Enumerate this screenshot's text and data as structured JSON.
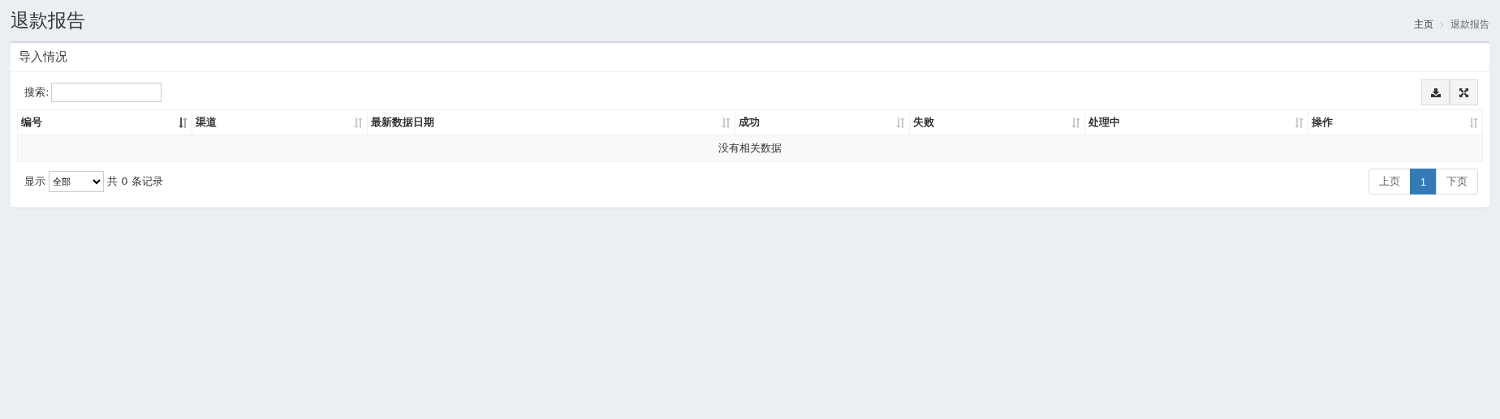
{
  "page_title": "退款报告",
  "breadcrumb": [
    {
      "label": "主页"
    },
    {
      "label": "退款报告"
    }
  ],
  "panel": {
    "title": "导入情况",
    "search": {
      "label": "搜索:"
    },
    "table": {
      "columns": [
        {
          "label": "编号",
          "sorted": true
        },
        {
          "label": "渠道",
          "sorted": false
        },
        {
          "label": "最新数据日期",
          "sorted": false
        },
        {
          "label": "成功",
          "sorted": false
        },
        {
          "label": "失败",
          "sorted": false
        },
        {
          "label": "处理中",
          "sorted": false
        },
        {
          "label": "操作",
          "sorted": false
        }
      ],
      "empty_message": "没有相关数据"
    },
    "footer": {
      "show_label": "显示",
      "page_size": "全部",
      "record_count": "共 0 条记录"
    },
    "pagination": [
      {
        "label": "上页",
        "selected": false
      },
      {
        "label": "1",
        "selected": true
      },
      {
        "label": "下页",
        "selected": false
      }
    ]
  }
}
